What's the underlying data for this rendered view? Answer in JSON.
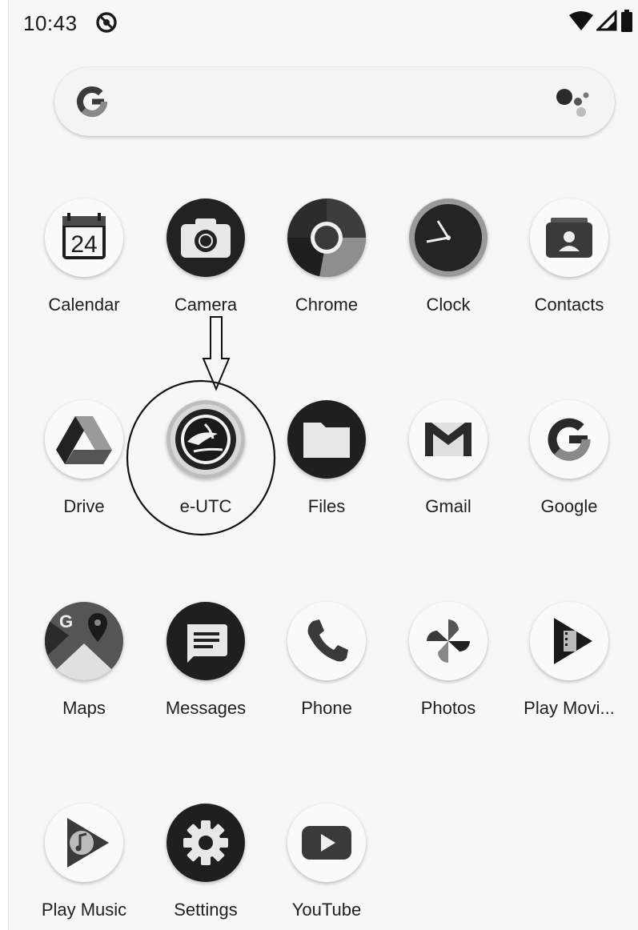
{
  "status_bar": {
    "time": "10:43",
    "notification_icon": "sync-off-icon",
    "wifi_icon": "wifi-icon",
    "signal_icon": "cell-signal-icon",
    "battery_icon": "battery-icon"
  },
  "search_bar": {
    "logo_icon": "google-g-icon",
    "assistant_icon": "google-assistant-icon"
  },
  "apps": [
    {
      "label": "Calendar",
      "icon": "calendar-icon",
      "date_number": "24"
    },
    {
      "label": "Camera",
      "icon": "camera-icon"
    },
    {
      "label": "Chrome",
      "icon": "chrome-icon"
    },
    {
      "label": "Clock",
      "icon": "clock-icon"
    },
    {
      "label": "Contacts",
      "icon": "contacts-icon"
    },
    {
      "label": "Drive",
      "icon": "drive-icon"
    },
    {
      "label": "e-UTC",
      "icon": "e-utc-logo-icon"
    },
    {
      "label": "Files",
      "icon": "folder-icon"
    },
    {
      "label": "Gmail",
      "icon": "gmail-icon"
    },
    {
      "label": "Google",
      "icon": "google-icon"
    },
    {
      "label": "Maps",
      "icon": "maps-icon"
    },
    {
      "label": "Messages",
      "icon": "messages-icon"
    },
    {
      "label": "Phone",
      "icon": "phone-icon"
    },
    {
      "label": "Photos",
      "icon": "photos-icon"
    },
    {
      "label": "Play Movi...",
      "icon": "play-movies-icon"
    },
    {
      "label": "Play Music",
      "icon": "play-music-icon"
    },
    {
      "label": "Settings",
      "icon": "settings-icon"
    },
    {
      "label": "YouTube",
      "icon": "youtube-icon"
    }
  ],
  "annotation": {
    "arrow": "down-arrow-annotation",
    "circle": "highlight-circle-annotation",
    "target": "e-UTC"
  }
}
